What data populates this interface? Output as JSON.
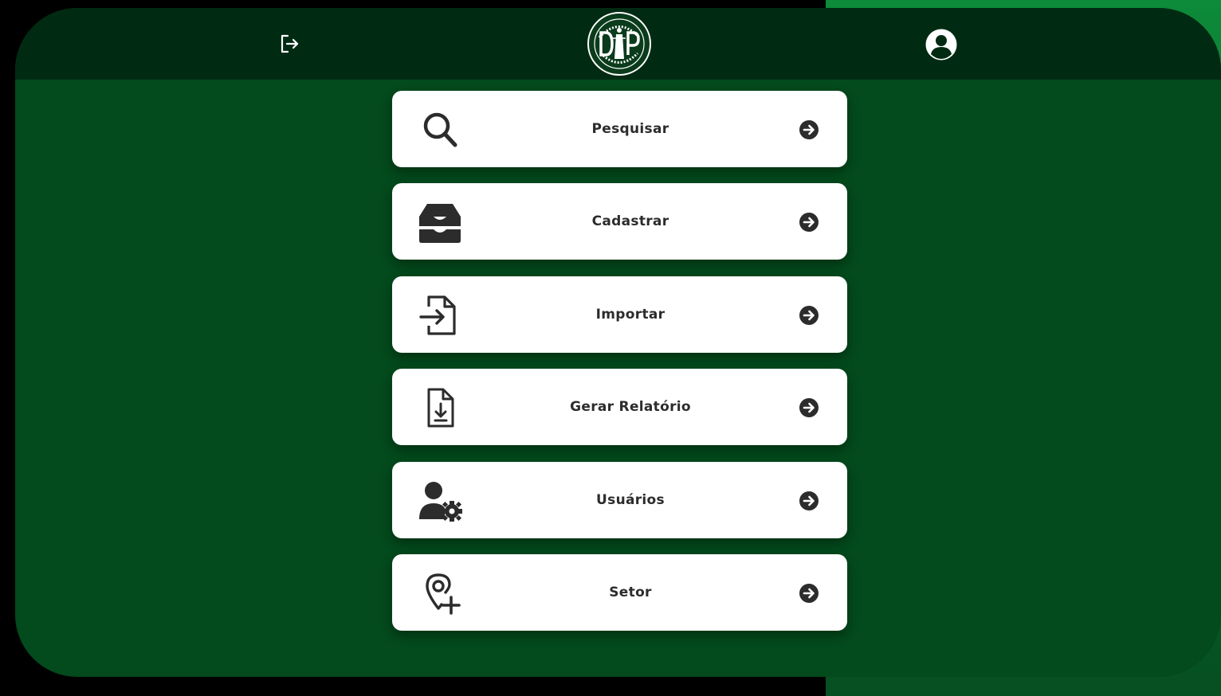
{
  "colors": {
    "page_bg": "#000000",
    "accent_panel": "#0d8a3a",
    "frame_bg": "#034a1c",
    "topbar_bg": "#002b12",
    "card_bg": "#ffffff",
    "icon_color": "#2c2c2c"
  },
  "header": {
    "logout_icon": "logout-icon",
    "logo_icon": "dp-logo-icon",
    "profile_icon": "user-circle-icon"
  },
  "menu": {
    "items": [
      {
        "label": "Pesquisar",
        "icon": "search-icon"
      },
      {
        "label": "Cadastrar",
        "icon": "inbox-icon"
      },
      {
        "label": "Importar",
        "icon": "file-import-icon"
      },
      {
        "label": "Gerar Relatório",
        "icon": "file-download-icon"
      },
      {
        "label": "Usuários",
        "icon": "user-gear-icon"
      },
      {
        "label": "Setor",
        "icon": "location-plus-icon"
      }
    ],
    "arrow_icon": "arrow-circle-right-icon"
  }
}
